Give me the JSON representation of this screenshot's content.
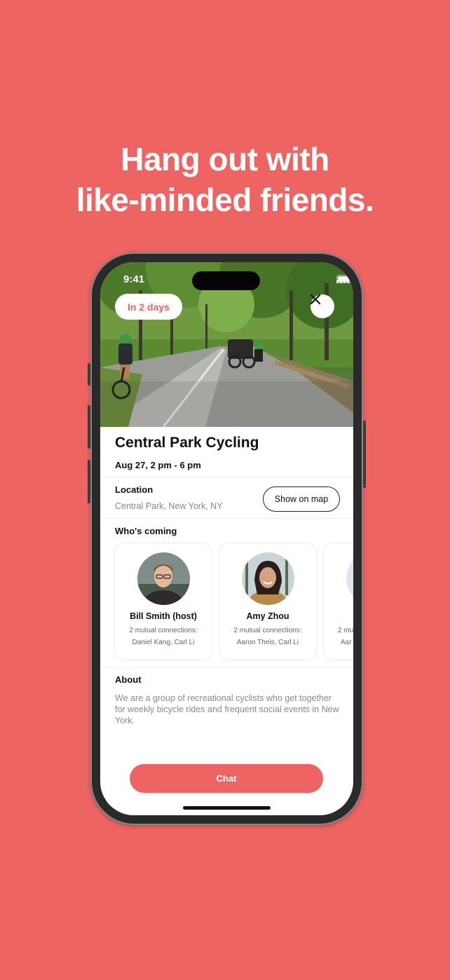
{
  "headline": {
    "line1": "Hang out with",
    "line2": "like-minded friends."
  },
  "status_bar": {
    "time": "9:41"
  },
  "event": {
    "when_badge": "In 2 days",
    "title": "Central Park Cycling",
    "date": "Aug 27, 2 pm - 6 pm"
  },
  "location": {
    "label": "Location",
    "value": "Central Park, New York, NY",
    "map_button": "Show on map"
  },
  "attendees": {
    "label": "Who's coming",
    "people": [
      {
        "name": "Bill Smith (host)",
        "mutual": "2 mutual connections:",
        "names": "Daniel Kang, Carl Li"
      },
      {
        "name": "Amy Zhou",
        "mutual": "2 mutual connections:",
        "names": "Aaron Theis, Carl Li"
      },
      {
        "name": "",
        "mutual": "2 mu",
        "names": "Aar"
      }
    ]
  },
  "about": {
    "label": "About",
    "text": "We are a group of recreational cyclists who get together for weekly bicycle rides and frequent social events in New York."
  },
  "chat_button": "Chat",
  "colors": {
    "brand": "#ED6462"
  }
}
